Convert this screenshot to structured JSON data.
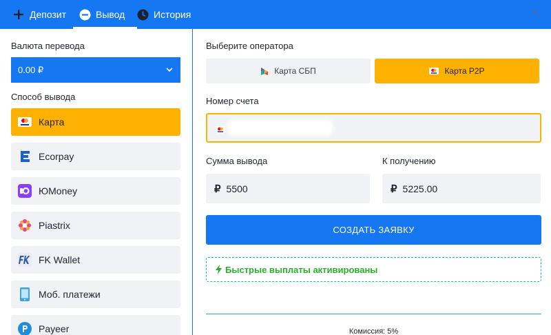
{
  "tabs": {
    "deposit": "Депозит",
    "withdraw": "Вывод",
    "history": "История"
  },
  "left": {
    "currency_label": "Валюта перевода",
    "currency_value": "0.00 ₽",
    "method_label": "Способ вывода",
    "methods": [
      {
        "label": "Карта",
        "icon": "card-icon",
        "active": true
      },
      {
        "label": "Ecorpay",
        "icon": "ecorpay-icon"
      },
      {
        "label": "ЮMoney",
        "icon": "yoomoney-icon"
      },
      {
        "label": "Piastrix",
        "icon": "piastrix-icon"
      },
      {
        "label": "FK Wallet",
        "icon": "fkwallet-icon"
      },
      {
        "label": "Моб. платежи",
        "icon": "mobile-phone-icon"
      },
      {
        "label": "Payeer",
        "icon": "payeer-icon"
      }
    ]
  },
  "right": {
    "operator_label": "Выберите оператора",
    "operators": [
      {
        "label": "Карта СБП",
        "icon": "sbp-icon"
      },
      {
        "label": "Карта P2P",
        "icon": "card-icon",
        "active": true
      }
    ],
    "account_label": "Номер счета",
    "account_value": "",
    "amount_label": "Сумма вывода",
    "amount_value": "5500",
    "receive_label": "К получению",
    "receive_value": "5225.00",
    "currency_symbol": "₽",
    "create_button": "СОЗДАТЬ ЗАЯВКУ",
    "fast_payout": "Быстрые выплаты активированы",
    "commission": "Комиссия: 5%"
  },
  "colors": {
    "primary": "#1677f2",
    "accent": "#ffb100",
    "success": "#27b12a",
    "teal": "#19b9a6",
    "panel": "#f1f2f5"
  }
}
